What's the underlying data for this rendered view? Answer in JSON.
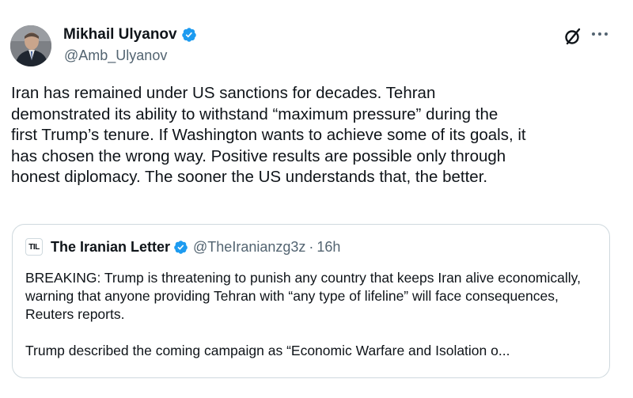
{
  "tweet": {
    "author_name": "Mikhail Ulyanov",
    "handle": "@Amb_Ulyanov",
    "lines": [
      "Iran has remained under US sanctions for decades. Tehran",
      "demonstrated its ability to withstand “maximum pressure” during the",
      "first Trump’s tenure. If Washington wants to achieve some of its goals, it",
      "has chosen the wrong way. Positive results are possible only through",
      "honest diplomacy. The sooner the US understands that, the better."
    ]
  },
  "quoted_tweet": {
    "logo_text": "TIL",
    "author_name": "The Iranian Letter",
    "handle": "@TheIranianzg3z",
    "separator": "·",
    "time": "16h",
    "paragraphs": [
      "BREAKING: Trump is threatening to punish any country that keeps Iran alive economically, warning that anyone providing Tehran with “any type of lifeline” will face consequences, Reuters reports.",
      "Trump described the coming campaign as “Economic Warfare and Isolation o..."
    ]
  },
  "icons": {
    "verified": "verified-badge-icon",
    "grok": "grok-icon",
    "more": "more-options-icon"
  },
  "colors": {
    "verified_blue": "#1d9bf0",
    "text": "#0f1419",
    "secondary": "#536471",
    "border": "#cfd9de"
  }
}
